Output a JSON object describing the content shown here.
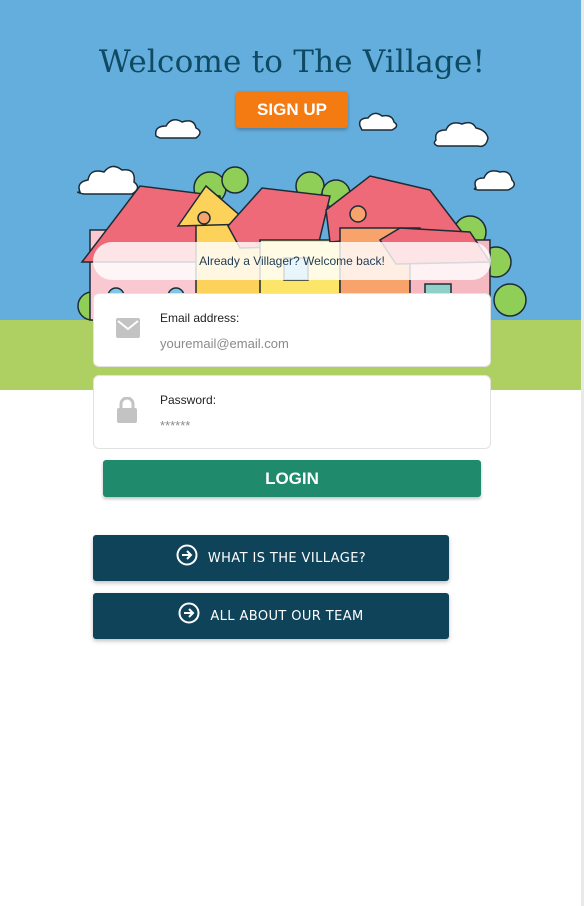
{
  "hero": {
    "title": "Welcome to The Village!",
    "signup_label": "SIGN UP",
    "colors": {
      "sky": "#64aedd",
      "grass": "#aecf62",
      "title": "#0f4a63",
      "signup": "#f47a12"
    }
  },
  "login": {
    "welcome_text": "Already a Villager? Welcome back!",
    "email": {
      "label": "Email address:",
      "placeholder": "youremail@email.com",
      "icon": "envelope-icon"
    },
    "password": {
      "label": "Password:",
      "placeholder": "******",
      "icon": "lock-icon"
    },
    "login_label": "LOGIN",
    "login_color": "#208a6d"
  },
  "links": [
    {
      "label": "WHAT IS THE VILLAGE?",
      "icon": "arrow-circle-right-icon"
    },
    {
      "label": "ALL ABOUT OUR TEAM",
      "icon": "arrow-circle-right-icon"
    }
  ],
  "links_color": "#0e4359"
}
